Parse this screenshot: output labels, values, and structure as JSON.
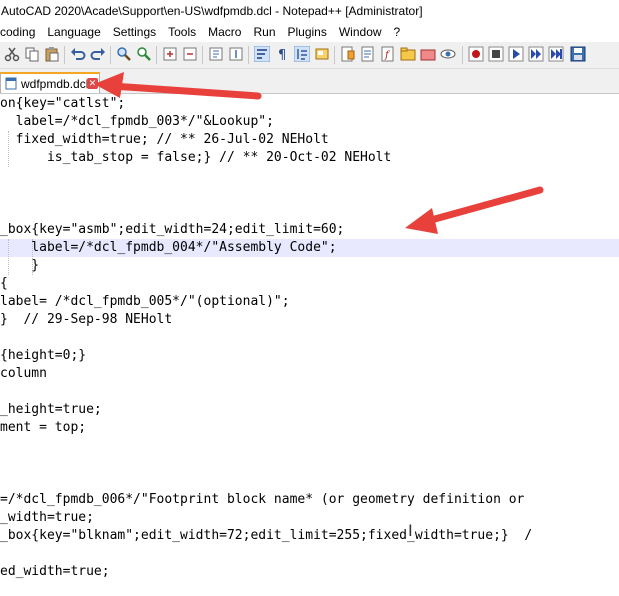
{
  "window": {
    "title": "AutoCAD 2020\\Acade\\Support\\en-US\\wdfpmdb.dcl - Notepad++ [Administrator]"
  },
  "menu": [
    "coding",
    "Language",
    "Settings",
    "Tools",
    "Macro",
    "Run",
    "Plugins",
    "Window",
    "?"
  ],
  "toolbar": {
    "icons": [
      "cut-icon",
      "copy-icon",
      "paste-icon",
      "undo-icon",
      "redo-icon",
      "find-icon",
      "replace-icon",
      "zoom-in-icon",
      "zoom-out-icon",
      "sync-vertical-icon",
      "sync-horizontal-icon",
      "word-wrap-icon",
      "show-all-chars-icon",
      "indent-guide-icon",
      "user-lang-icon",
      "doc-map-icon",
      "function-list-icon",
      "folder-workspace-icon",
      "monitor-icon",
      "record-macro-icon",
      "stop-record-icon",
      "play-macro-icon",
      "run-macro-multiple-icon",
      "save-macro-icon"
    ]
  },
  "tab": {
    "label": "wdfpmdb.dcl"
  },
  "editor": {
    "lines": [
      "on{key=\"catlst\";",
      "  label=/*dcl_fpmdb_003*/\"&Lookup\";",
      "  fixed_width=true; // ** 26-Jul-02 NEHolt",
      "      is_tab_stop = false;} // ** 20-Oct-02 NEHolt",
      "",
      "",
      "",
      "_box{key=\"asmb\";edit_width=24;edit_limit=60;",
      "    label=/*dcl_fpmdb_004*/\"Assembly Code\";",
      "    }",
      "{",
      "label= /*dcl_fpmdb_005*/\"(optional)\";",
      "}  // 29-Sep-98 NEHolt",
      "",
      "{height=0;}",
      "column",
      "",
      "_height=true;",
      "ment = top;",
      "",
      "",
      "",
      "=/*dcl_fpmdb_006*/\"Footprint block name* (or geometry definition or ",
      "_width=true;",
      "_box{key=\"blknam\";edit_width=72;edit_limit=255;fixed_width=true;}  /",
      "",
      "ed_width=true;"
    ]
  },
  "colors": {
    "arrow": "#e8413c",
    "tab_accent": "#f5a623",
    "current_line": "#e8e8ff"
  }
}
